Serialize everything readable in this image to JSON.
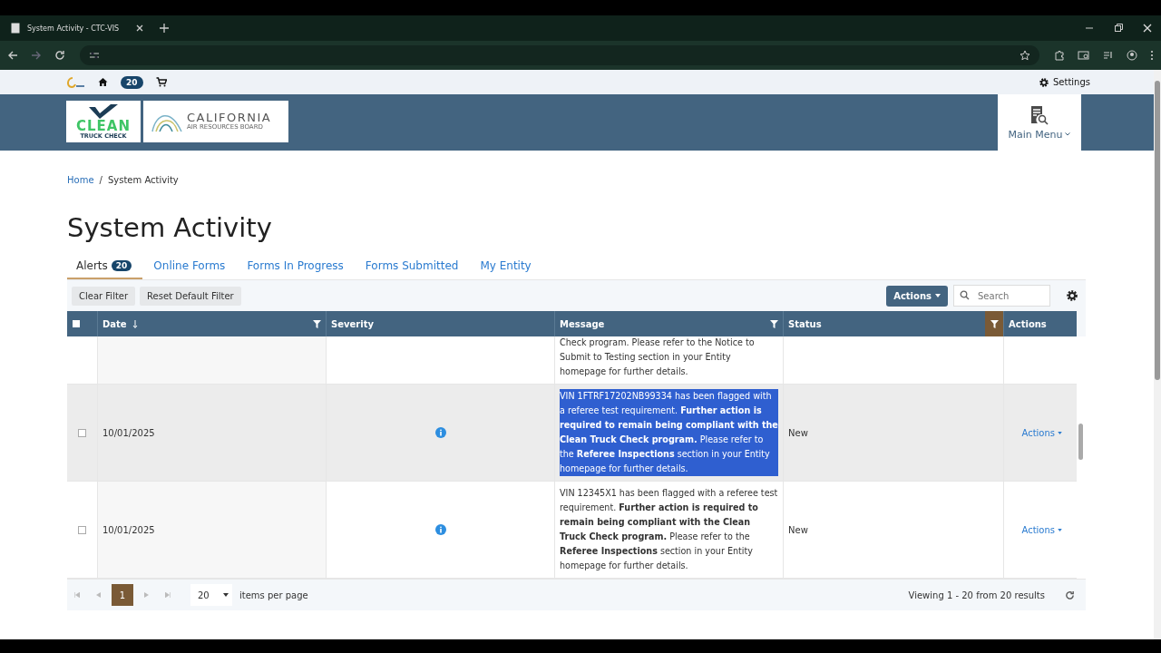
{
  "browser": {
    "tab_title": "System Activity - CTC-VIS"
  },
  "top_bar": {
    "badge": "20",
    "settings": "Settings"
  },
  "header": {
    "logo_line1": "CLEAN",
    "logo_line2": "TRUCK CHECK",
    "carb_title": "CALIFORNIA",
    "carb_subtitle": "AIR RESOURCES BOARD",
    "main_menu": "Main Menu"
  },
  "breadcrumb": [
    {
      "label": "Home",
      "kind": "link"
    },
    {
      "label": "/",
      "kind": "separator"
    },
    {
      "label": "System Activity",
      "kind": "current"
    }
  ],
  "page_title": "System Activity",
  "tabs": [
    {
      "label": "Alerts",
      "count": "20",
      "selected": true
    },
    {
      "label": "Online Forms",
      "selected": false
    },
    {
      "label": "Forms In Progress",
      "selected": false
    },
    {
      "label": "Forms Submitted",
      "selected": false
    },
    {
      "label": "My Entity",
      "selected": false
    }
  ],
  "toolbar": {
    "clear_filter": "Clear Filter",
    "reset_filter": "Reset Default Filter",
    "actions": "Actions",
    "search_placeholder": "Search"
  },
  "table": {
    "select_all_checked": false,
    "columns": [
      {
        "label": "Date",
        "kind": "sorted_filter"
      },
      {
        "label": "Severity",
        "kind": "plain"
      },
      {
        "label": "Message",
        "kind": "filter"
      },
      {
        "label": "Status",
        "kind": "active_filter"
      },
      {
        "label": "Actions",
        "kind": "plain"
      }
    ],
    "rows": [
      {
        "kind": "partial",
        "message": "Check program. Please refer to the Notice to Submit to Testing section in your Entity homepage for further details.",
        "hovered": false,
        "text_highlighted": false
      },
      {
        "kind": "full",
        "date": "10/01/2025",
        "message": "VIN 1FTRF17202NB99334 has been flagged with a referee test requirement. **Further action is required to remain being compliant with the Clean Truck Check program.** Please refer to the **Referee Inspections** section in your Entity homepage for further details.",
        "status": "New",
        "action": "Actions",
        "hovered": true,
        "text_highlighted": true,
        "checked": false
      },
      {
        "kind": "full",
        "date": "10/01/2025",
        "message": "VIN 12345X1 has been flagged with a referee test requirement. **Further action is required to remain being compliant with the Clean Truck Check program.** Please refer to the **Referee Inspections** section in your Entity homepage for further details.",
        "status": "New",
        "action": "Actions",
        "hovered": false,
        "text_highlighted": false,
        "checked": false
      }
    ]
  },
  "pager": {
    "page": "1",
    "page_size": "20",
    "items_label": "items per page",
    "summary": "Viewing 1 - 20 from 20 results"
  }
}
